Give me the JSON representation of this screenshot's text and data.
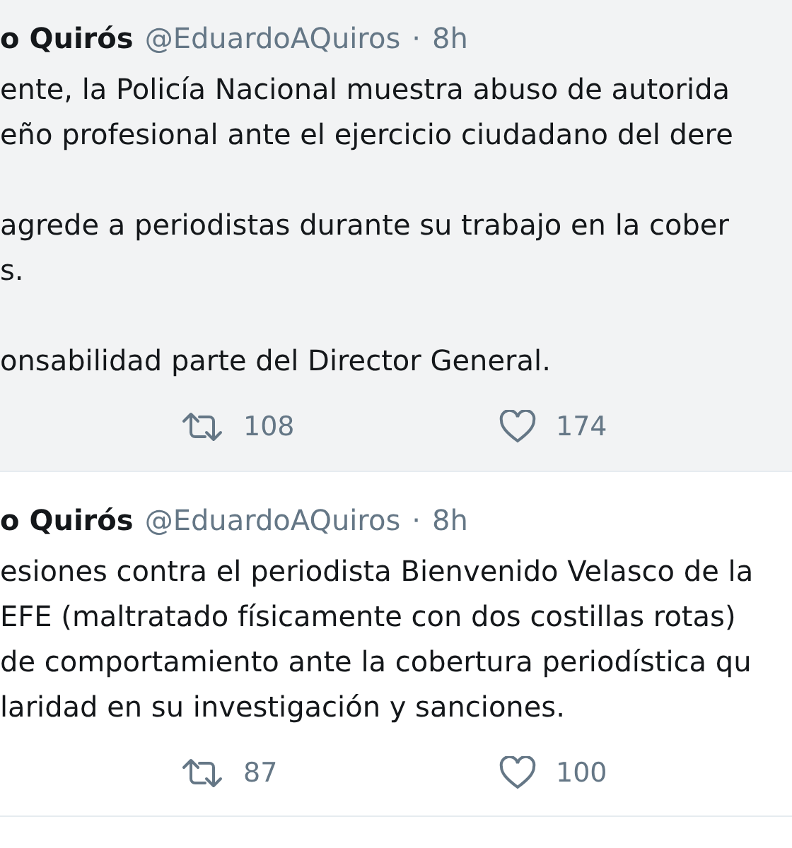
{
  "tweets": [
    {
      "name": "o Quirós",
      "handle": "@EduardoAQuiros",
      "separator": "·",
      "time": "8h",
      "hovered": true,
      "paragraphs": [
        [
          "ente, la Policía Nacional muestra abuso de autorida",
          "eño profesional ante el ejercicio ciudadano del dere"
        ],
        [
          "agrede a periodistas durante su trabajo en la cober",
          "s."
        ],
        [
          "onsabilidad parte del Director General."
        ]
      ],
      "retweets": "108",
      "likes": "174"
    },
    {
      "name": "o Quirós",
      "handle": "@EduardoAQuiros",
      "separator": "·",
      "time": "8h",
      "hovered": false,
      "paragraphs": [
        [
          "esiones contra el periodista Bienvenido Velasco de la",
          "EFE (maltratado físicamente con dos costillas rotas)",
          "de comportamiento ante la cobertura periodística qu",
          "laridad en su investigación y sanciones."
        ]
      ],
      "retweets": "87",
      "likes": "100"
    }
  ]
}
